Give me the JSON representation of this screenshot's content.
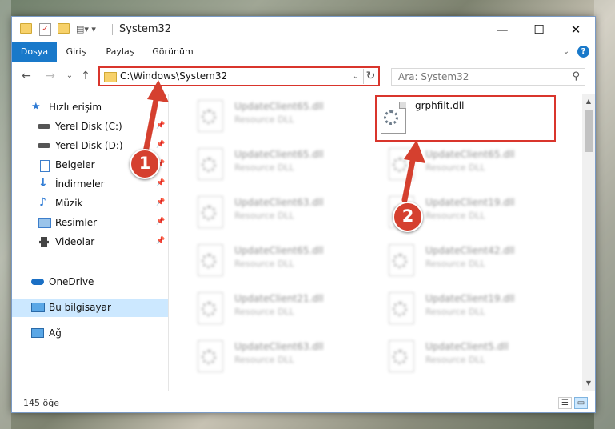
{
  "titlebar": {
    "title": "System32",
    "minimize": "—",
    "maximize": "☐",
    "close": "✕"
  },
  "ribbon": {
    "tabs": [
      "Dosya",
      "Giriş",
      "Paylaş",
      "Görünüm"
    ],
    "help": "?"
  },
  "nav": {
    "path": "C:\\Windows\\System32",
    "search_placeholder": "Ara: System32",
    "back": "←",
    "forward": "→",
    "recent": "⌄",
    "up": "↑",
    "refresh": "↻"
  },
  "sidebar": {
    "quick_access": "Hızlı erişim",
    "pinned": [
      "Yerel Disk (C:)",
      "Yerel Disk (D:)",
      "Belgeler",
      "İndirmeler",
      "Müzik",
      "Resimler",
      "Videolar"
    ],
    "onedrive": "OneDrive",
    "this_pc": "Bu bilgisayar",
    "network": "Ağ",
    "pin_glyph": "📌"
  },
  "files": {
    "highlighted": "grphfilt.dll",
    "left_column": [
      {
        "name": "UpdateClient65.dll",
        "type": "Resource DLL"
      },
      {
        "name": "UpdateClient65.dll",
        "type": "Resource DLL"
      },
      {
        "name": "UpdateClient63.dll",
        "type": "Resource DLL"
      },
      {
        "name": "UpdateClient65.dll",
        "type": "Resource DLL"
      },
      {
        "name": "UpdateClient21.dll",
        "type": "Resource DLL"
      },
      {
        "name": "UpdateClient63.dll",
        "type": "Resource DLL"
      }
    ],
    "right_column": [
      {
        "name": "UpdateClient65.dll",
        "type": "Resource DLL"
      },
      {
        "name": "UpdateClient19.dll",
        "type": "Resource DLL"
      },
      {
        "name": "UpdateClient42.dll",
        "type": "Resource DLL"
      },
      {
        "name": "UpdateClient19.dll",
        "type": "Resource DLL"
      },
      {
        "name": "UpdateClient5.dll",
        "type": "Resource DLL"
      }
    ]
  },
  "status": {
    "count": "145 öğe"
  },
  "callouts": [
    "1",
    "2"
  ],
  "colors": {
    "accent": "#1979ca",
    "highlight": "#d9352c",
    "callout": "#d5402f"
  }
}
